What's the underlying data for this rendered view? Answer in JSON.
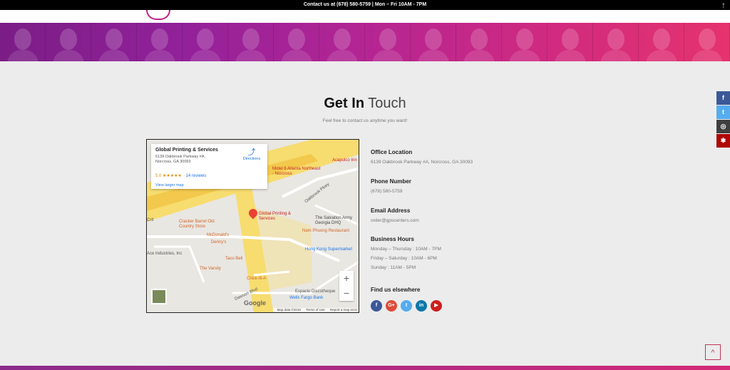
{
  "topbar": {
    "text": "Contact us at (678) 580-5759 | Mon – Fri  10AM - 7PM"
  },
  "heading": {
    "bold": "Get In",
    "light": "Touch",
    "subtitle": "Feel free to contact us anytime you want!"
  },
  "map": {
    "business_name": "Global Printing & Services",
    "address_line1": "6139 Oakbrook Parkway #A,",
    "address_line2": "Norcross, GA 30093",
    "rating": "5.0 ★★★★★",
    "reviews": "14 reviews",
    "larger_map": "View larger map",
    "directions": "Directions",
    "pin_label": "Global Printing & Services",
    "labels": {
      "acapulco": "Acapulco Inn",
      "motel6": "Motel 6 Atlanta Northeast - Norcross",
      "oakbrook": "Oakbrook Pkwy",
      "cracker": "Cracker Barrel Old Country Store",
      "mcdonalds": "McDonald's",
      "dennys": "Denny's",
      "salvation": "The Salvation Army Georgia DHQ",
      "nam": "Nam Phuong Restaurant",
      "hongkong": "Hong Kong Supermarket",
      "ace": "Ace Industries, Inc",
      "taco": "Taco Bell",
      "varsity": "The Varsity",
      "chick": "Chick-fil-A",
      "espacio": "Espacio Discotheque",
      "wells": "Wells Fargo Bank",
      "dawson": "Dawson Blvd",
      "crit": "Crit"
    },
    "google": "Google",
    "footer": {
      "data": "Map data ©2019",
      "terms": "Terms of Use",
      "report": "Report a map error"
    }
  },
  "contact": {
    "office_title": "Office Location",
    "office_value": "6139 Oakbrook Parkway #A, Norcross, GA 30093",
    "phone_title": "Phone Number",
    "phone_value": "(678) 580-5759",
    "email_title": "Email Address",
    "email_value": "order@gpscenters.com",
    "hours_title": "Business Hours",
    "hours": [
      "Monday – Thursday : 10AM - 7PM",
      "Friday – Saturday : 10AM - 6PM",
      "Sunday : 11AM - 5PM"
    ],
    "find_title": "Find us elsewhere",
    "socials": [
      {
        "icon": "facebook-icon",
        "glyph": "f",
        "color": "#3b5998"
      },
      {
        "icon": "google-plus-icon",
        "glyph": "G+",
        "color": "#dd4b39"
      },
      {
        "icon": "twitter-icon",
        "glyph": "t",
        "color": "#55acee"
      },
      {
        "icon": "linkedin-icon",
        "glyph": "in",
        "color": "#0e76a8"
      },
      {
        "icon": "youtube-icon",
        "glyph": "▶",
        "color": "#cd201f"
      }
    ]
  },
  "sidebar": [
    {
      "icon": "facebook-icon",
      "glyph": "f",
      "color": "#3b5998"
    },
    {
      "icon": "twitter-icon",
      "glyph": "t",
      "color": "#55acee"
    },
    {
      "icon": "instagram-icon",
      "glyph": "◎",
      "color": "#3f3f3f"
    },
    {
      "icon": "yelp-icon",
      "glyph": "✱",
      "color": "#af0606"
    }
  ],
  "totop": "^"
}
